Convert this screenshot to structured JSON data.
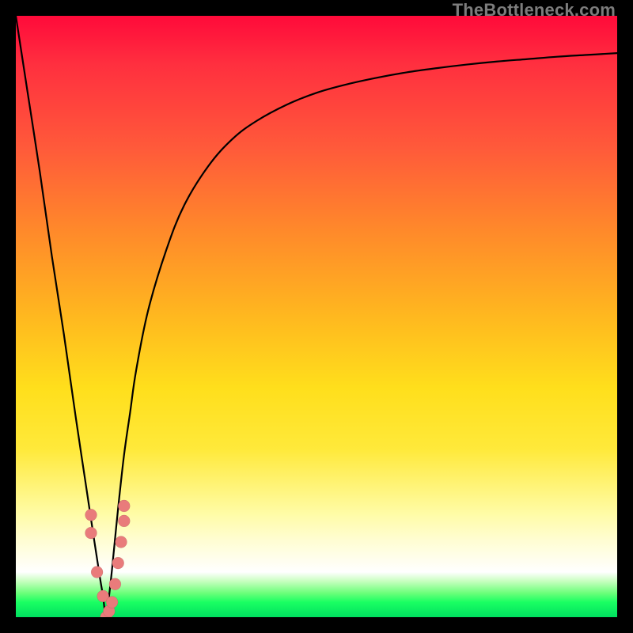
{
  "watermark": "TheBottleneck.com",
  "chart_data": {
    "type": "line",
    "title": "",
    "xlabel": "",
    "ylabel": "",
    "x": [
      0.0,
      0.02,
      0.04,
      0.06,
      0.08,
      0.1,
      0.115,
      0.13,
      0.14,
      0.145,
      0.15,
      0.155,
      0.16,
      0.17,
      0.18,
      0.19,
      0.2,
      0.22,
      0.25,
      0.28,
      0.32,
      0.36,
      0.4,
      0.45,
      0.5,
      0.55,
      0.6,
      0.65,
      0.7,
      0.75,
      0.8,
      0.85,
      0.9,
      0.95,
      1.0
    ],
    "values": [
      1.0,
      0.87,
      0.74,
      0.6,
      0.47,
      0.33,
      0.23,
      0.13,
      0.065,
      0.035,
      0.0,
      0.035,
      0.08,
      0.18,
      0.27,
      0.34,
      0.41,
      0.51,
      0.61,
      0.685,
      0.75,
      0.795,
      0.825,
      0.852,
      0.872,
      0.886,
      0.897,
      0.906,
      0.913,
      0.919,
      0.924,
      0.928,
      0.932,
      0.935,
      0.938
    ],
    "xlim": [
      0,
      1
    ],
    "ylim": [
      0,
      1
    ],
    "background_gradient": [
      "#ff0a3a",
      "#ffb81f",
      "#ffe93a",
      "#ffffff",
      "#00e060"
    ],
    "markers": {
      "x": [
        0.125,
        0.125,
        0.135,
        0.145,
        0.15,
        0.155,
        0.16,
        0.165,
        0.17,
        0.175,
        0.18,
        0.18
      ],
      "y": [
        0.17,
        0.14,
        0.075,
        0.035,
        0.0,
        0.01,
        0.025,
        0.055,
        0.09,
        0.125,
        0.16,
        0.185
      ],
      "color": "#e97b7b"
    },
    "has_grid": false,
    "has_legend": false
  }
}
